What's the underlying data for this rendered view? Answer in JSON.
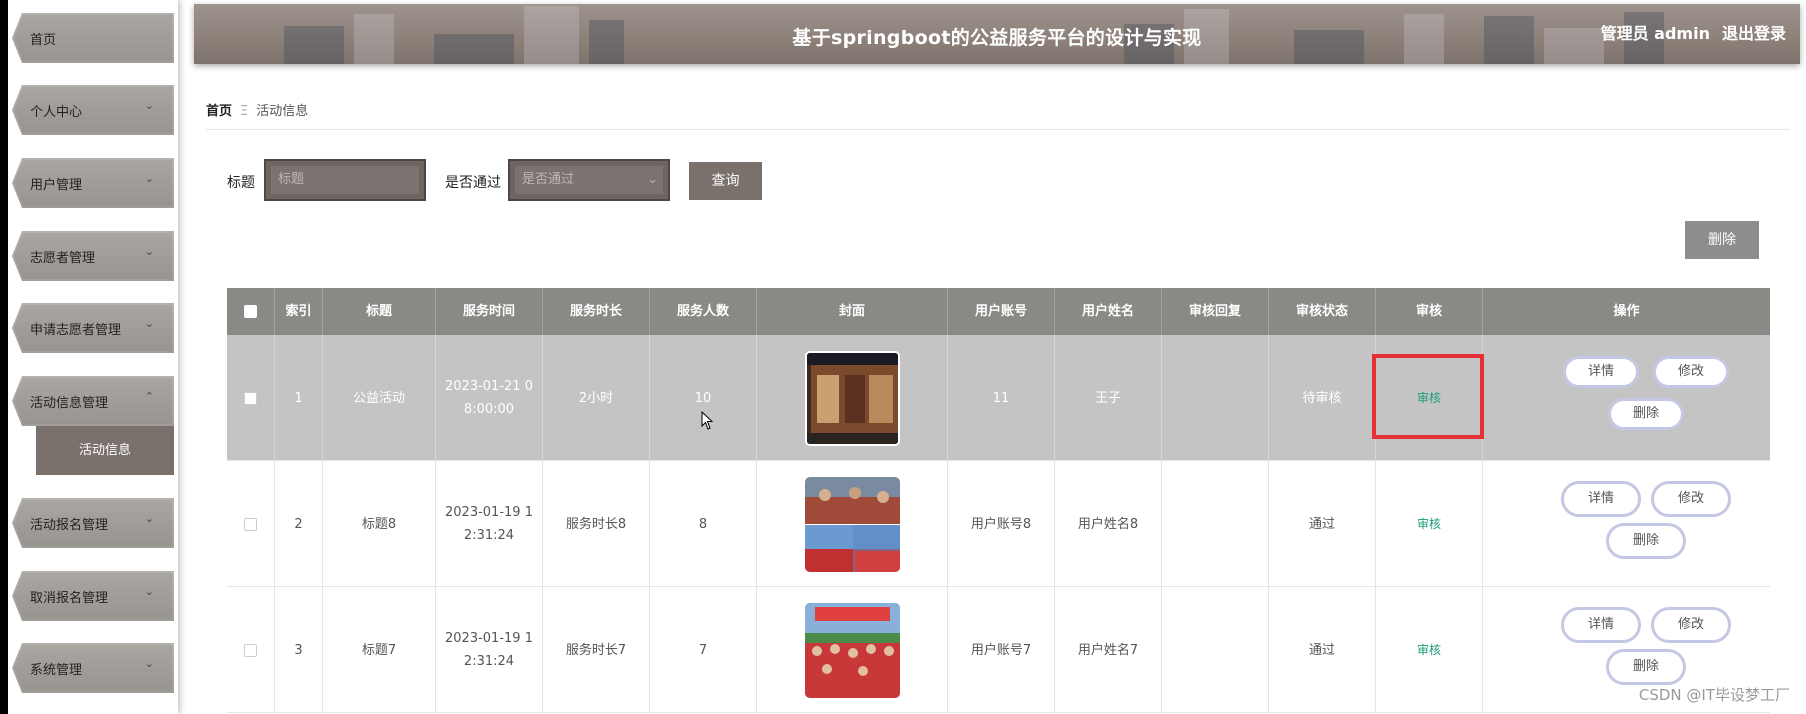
{
  "header": {
    "title": "基于springboot的公益服务平台的设计与实现",
    "user_label": "管理员 admin",
    "logout": "退出登录"
  },
  "sidebar": {
    "items": [
      {
        "label": "首页",
        "has_chevron": false
      },
      {
        "label": "个人中心",
        "has_chevron": true
      },
      {
        "label": "用户管理",
        "has_chevron": true
      },
      {
        "label": "志愿者管理",
        "has_chevron": true
      },
      {
        "label": "申请志愿者管理",
        "has_chevron": true
      },
      {
        "label": "活动信息管理",
        "has_chevron": true,
        "expanded": true
      },
      {
        "label": "活动报名管理",
        "has_chevron": true
      },
      {
        "label": "取消报名管理",
        "has_chevron": true
      },
      {
        "label": "系统管理",
        "has_chevron": true
      }
    ],
    "sub_item": "活动信息"
  },
  "breadcrumb": {
    "home": "首页",
    "separator": "Ξ",
    "current": "活动信息"
  },
  "search": {
    "title_label": "标题",
    "title_placeholder": "标题",
    "passed_label": "是否通过",
    "passed_placeholder": "是否通过",
    "query_button": "查询",
    "delete_button": "删除"
  },
  "table": {
    "headers": [
      "",
      "索引",
      "标题",
      "服务时间",
      "服务时长",
      "服务人数",
      "封面",
      "用户账号",
      "用户姓名",
      "审核回复",
      "审核状态",
      "审核",
      "操作"
    ],
    "rows": [
      {
        "index": "1",
        "title": "公益活动",
        "service_time_1": "2023-01-21 0",
        "service_time_2": "8:00:00",
        "duration": "2小时",
        "people": "10",
        "account": "11",
        "name": "王子",
        "reply": "",
        "status": "待审核",
        "audit": "审核",
        "highlighted": true
      },
      {
        "index": "2",
        "title": "标题8",
        "service_time_1": "2023-01-19 1",
        "service_time_2": "2:31:24",
        "duration": "服务时长8",
        "people": "8",
        "account": "用户账号8",
        "name": "用户姓名8",
        "reply": "",
        "status": "通过",
        "audit": "审核",
        "highlighted": false
      },
      {
        "index": "3",
        "title": "标题7",
        "service_time_1": "2023-01-19 1",
        "service_time_2": "2:31:24",
        "duration": "服务时长7",
        "people": "7",
        "account": "用户账号7",
        "name": "用户姓名7",
        "reply": "",
        "status": "通过",
        "audit": "审核",
        "highlighted": false
      }
    ],
    "actions": {
      "detail": "详情",
      "edit": "修改",
      "delete": "删除"
    }
  },
  "watermark": "CSDN @IT毕设梦工厂",
  "colors": {
    "accent": "#7a716c",
    "table_header": "#8b8985",
    "highlight_row": "#c4c4c4",
    "audit_link": "#1e9c7a",
    "annotation_box": "#e53035",
    "pill_border": "#c5c8e4"
  }
}
